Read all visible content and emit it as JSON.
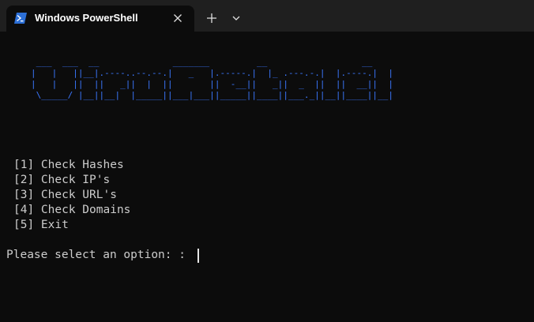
{
  "tab": {
    "title": "Windows PowerShell",
    "icon": "powershell-icon"
  },
  "tabbar": {
    "close_icon": "close-icon",
    "new_tab_icon": "plus-icon",
    "dropdown_icon": "chevron-down-icon"
  },
  "console": {
    "banner": [
      " ___  ___  __              _______         __                  __",
      "|   |   ||__|.----..--.--.|   _   |.-----.|  |_ .---.-.|  |.----.|  |",
      "|   |   ||  ||   _||  |  ||       ||  -__||   _||  _  ||  ||  __||  |",
      " \\_____/ |__||__|  |_____||___|___||_____||____||___._||__||____||__|"
    ],
    "menu": [
      "[1] Check Hashes",
      "[2] Check IP's",
      "[3] Check URL's",
      "[4] Check Domains",
      "[5] Exit"
    ],
    "prompt": "Please select an option: :"
  },
  "colors": {
    "background": "#0c0c0c",
    "tabbar": "#1f1f1f",
    "banner": "#3b78ff",
    "text": "#cccccc",
    "powershell_blue": "#2c6fd6"
  }
}
